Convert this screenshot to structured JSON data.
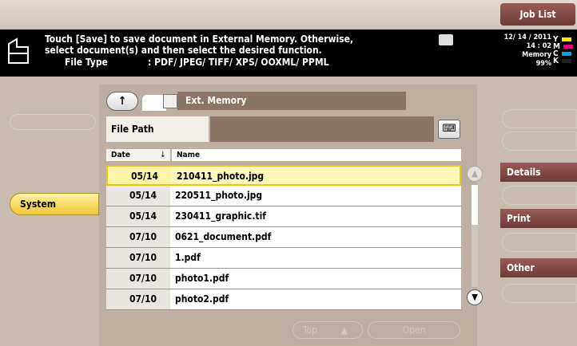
{
  "header": {
    "job_list": "Job List",
    "message_line1": "Touch [Save] to save document in External Memory. Otherwise,",
    "message_line2": "select document(s) and then select the desired function.",
    "file_type_label": "File Type",
    "file_type_value": ": PDF/ JPEG/ TIFF/ XPS/ OOXML/ PPML",
    "date": "12/ 14 / 2011",
    "time": "14 : 02",
    "memory_label": "Memory",
    "memory_value": "99%"
  },
  "toner": [
    {
      "letter": "Y",
      "color": "#ffe600"
    },
    {
      "letter": "M",
      "color": "#e6007e"
    },
    {
      "letter": "C",
      "color": "#00a0e9"
    },
    {
      "letter": "K",
      "color": "#222222"
    }
  ],
  "left_panel": {
    "ghost_label": "",
    "system_label": "System"
  },
  "center": {
    "title": "Ext. Memory",
    "file_path_label": "File Path",
    "file_path_value": "",
    "col_date": "Date",
    "col_name": "Name",
    "files": [
      {
        "date": "05/14",
        "name": "210411_photo.jpg",
        "selected": true
      },
      {
        "date": "05/14",
        "name": "220511_photo.jpg",
        "selected": false
      },
      {
        "date": "05/14",
        "name": "230411_graphic.tif",
        "selected": false
      },
      {
        "date": "07/10",
        "name": "0621_document.pdf",
        "selected": false
      },
      {
        "date": "07/10",
        "name": "1.pdf",
        "selected": false
      },
      {
        "date": "07/10",
        "name": "photo1.pdf",
        "selected": false
      },
      {
        "date": "07/10",
        "name": "photo2.pdf",
        "selected": false
      }
    ],
    "top_button": "Top",
    "open_button": "Open"
  },
  "right_panel": {
    "details": "Details",
    "print": "Print",
    "other": "Other"
  }
}
